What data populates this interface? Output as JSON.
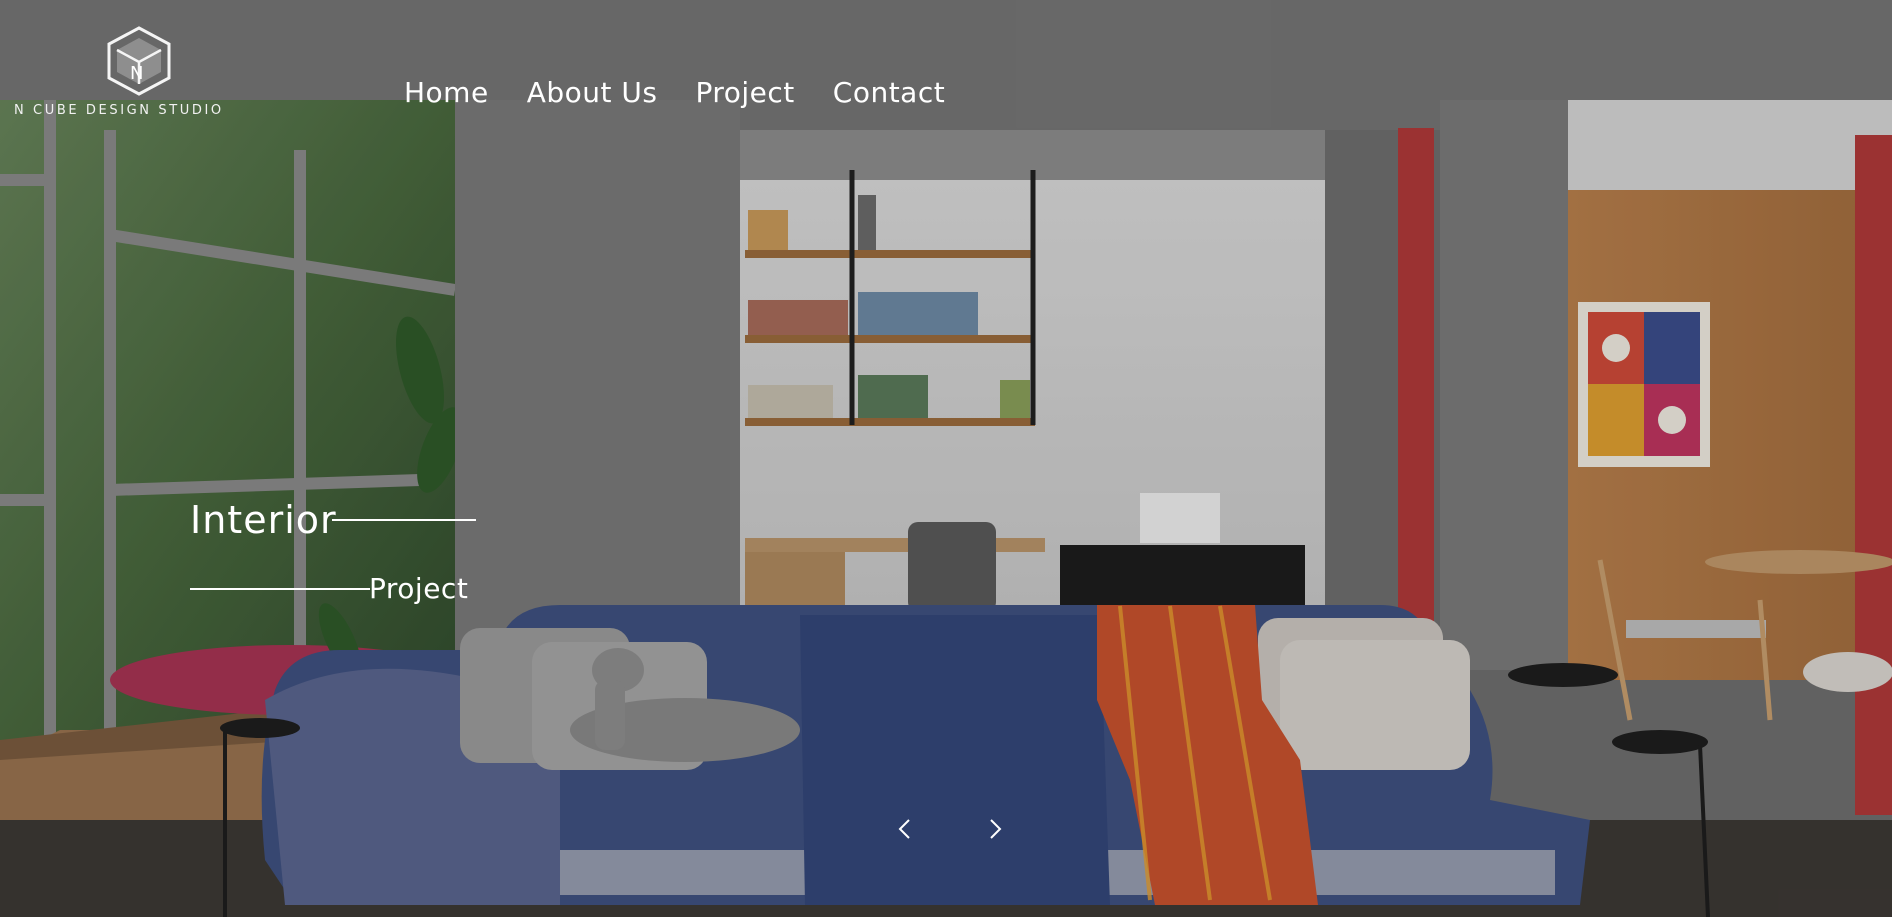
{
  "brand": {
    "logo_letter": "N",
    "name": "N CUBE DESIGN STUDIO"
  },
  "nav": {
    "items": [
      {
        "label": "Home"
      },
      {
        "label": "About Us"
      },
      {
        "label": "Project"
      },
      {
        "label": "Contact"
      }
    ]
  },
  "slide": {
    "title": "Interior",
    "subtitle": "Project"
  },
  "icons": {
    "logo": "cube-logo-icon",
    "prev": "chevron-left-icon",
    "next": "chevron-right-icon"
  },
  "colors": {
    "text": "#ffffff",
    "concrete": "#7d7d7d",
    "sofa_blue": "#3e5280",
    "accent_red": "#c0393b",
    "wood": "#b8844f"
  }
}
